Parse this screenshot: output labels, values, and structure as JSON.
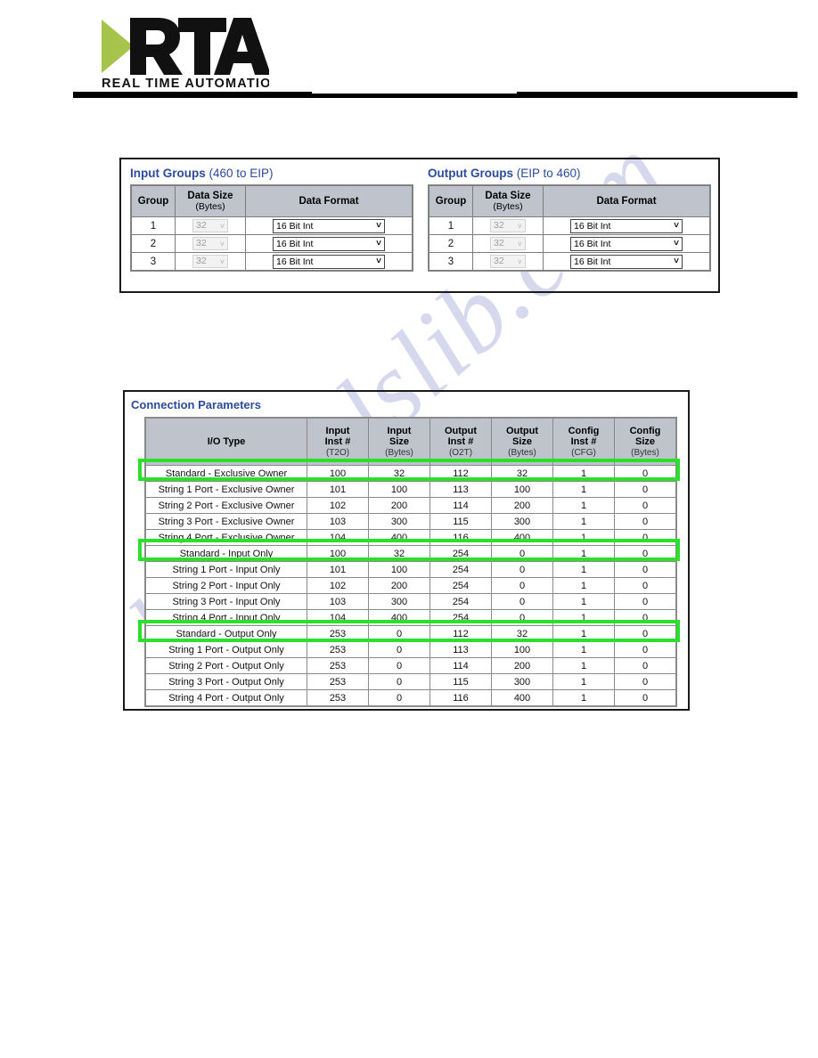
{
  "header": {
    "logo_main": "RTA",
    "logo_tagline": "REAL TIME AUTOMATION"
  },
  "watermark": {
    "text": "manualslib.com"
  },
  "groups_panel": {
    "input": {
      "title_bold": "Input Groups",
      "title_paren": " (460 to EIP)",
      "columns": [
        "Group",
        "Data Size",
        "(Bytes)",
        "Data Format"
      ],
      "col_group": "Group",
      "col_size": "Data Size",
      "col_size_sub": "(Bytes)",
      "col_format": "Data Format",
      "rows": [
        {
          "group": "1",
          "size": "32",
          "format": "16 Bit Int"
        },
        {
          "group": "2",
          "size": "32",
          "format": "16 Bit Int"
        },
        {
          "group": "3",
          "size": "32",
          "format": "16 Bit Int"
        }
      ]
    },
    "output": {
      "title_bold": "Output Groups",
      "title_paren": " (EIP to 460)",
      "col_group": "Group",
      "col_size": "Data Size",
      "col_size_sub": "(Bytes)",
      "col_format": "Data Format",
      "rows": [
        {
          "group": "1",
          "size": "32",
          "format": "16 Bit Int"
        },
        {
          "group": "2",
          "size": "32",
          "format": "16 Bit Int"
        },
        {
          "group": "3",
          "size": "32",
          "format": "16 Bit Int"
        }
      ]
    },
    "caret": "˅"
  },
  "connection_parameters": {
    "title": "Connection Parameters",
    "headers": [
      {
        "main": "I/O Type",
        "sub": ""
      },
      {
        "main": "Input",
        "main2": "Inst #",
        "sub": "(T2O)"
      },
      {
        "main": "Input",
        "main2": "Size",
        "sub": "(Bytes)"
      },
      {
        "main": "Output",
        "main2": "Inst #",
        "sub": "(O2T)"
      },
      {
        "main": "Output",
        "main2": "Size",
        "sub": "(Bytes)"
      },
      {
        "main": "Config",
        "main2": "Inst #",
        "sub": "(CFG)"
      },
      {
        "main": "Config",
        "main2": "Size",
        "sub": "(Bytes)"
      }
    ],
    "rows": [
      {
        "type": "Standard - Exclusive Owner",
        "input_inst": "100",
        "input_size": "32",
        "output_inst": "112",
        "output_size": "32",
        "config_inst": "1",
        "config_size": "0",
        "highlighted": true
      },
      {
        "type": "String 1 Port - Exclusive Owner",
        "input_inst": "101",
        "input_size": "100",
        "output_inst": "113",
        "output_size": "100",
        "config_inst": "1",
        "config_size": "0",
        "highlighted": false
      },
      {
        "type": "String 2 Port - Exclusive Owner",
        "input_inst": "102",
        "input_size": "200",
        "output_inst": "114",
        "output_size": "200",
        "config_inst": "1",
        "config_size": "0",
        "highlighted": false
      },
      {
        "type": "String 3 Port - Exclusive Owner",
        "input_inst": "103",
        "input_size": "300",
        "output_inst": "115",
        "output_size": "300",
        "config_inst": "1",
        "config_size": "0",
        "highlighted": false
      },
      {
        "type": "String 4 Port - Exclusive Owner",
        "input_inst": "104",
        "input_size": "400",
        "output_inst": "116",
        "output_size": "400",
        "config_inst": "1",
        "config_size": "0",
        "highlighted": false
      },
      {
        "type": "Standard - Input Only",
        "input_inst": "100",
        "input_size": "32",
        "output_inst": "254",
        "output_size": "0",
        "config_inst": "1",
        "config_size": "0",
        "highlighted": true
      },
      {
        "type": "String 1 Port - Input Only",
        "input_inst": "101",
        "input_size": "100",
        "output_inst": "254",
        "output_size": "0",
        "config_inst": "1",
        "config_size": "0",
        "highlighted": false
      },
      {
        "type": "String 2 Port - Input Only",
        "input_inst": "102",
        "input_size": "200",
        "output_inst": "254",
        "output_size": "0",
        "config_inst": "1",
        "config_size": "0",
        "highlighted": false
      },
      {
        "type": "String 3 Port - Input Only",
        "input_inst": "103",
        "input_size": "300",
        "output_inst": "254",
        "output_size": "0",
        "config_inst": "1",
        "config_size": "0",
        "highlighted": false
      },
      {
        "type": "String 4 Port - Input Only",
        "input_inst": "104",
        "input_size": "400",
        "output_inst": "254",
        "output_size": "0",
        "config_inst": "1",
        "config_size": "0",
        "highlighted": false
      },
      {
        "type": "Standard - Output Only",
        "input_inst": "253",
        "input_size": "0",
        "output_inst": "112",
        "output_size": "32",
        "config_inst": "1",
        "config_size": "0",
        "highlighted": true
      },
      {
        "type": "String 1 Port - Output Only",
        "input_inst": "253",
        "input_size": "0",
        "output_inst": "113",
        "output_size": "100",
        "config_inst": "1",
        "config_size": "0",
        "highlighted": false
      },
      {
        "type": "String 2 Port - Output Only",
        "input_inst": "253",
        "input_size": "0",
        "output_inst": "114",
        "output_size": "200",
        "config_inst": "1",
        "config_size": "0",
        "highlighted": false
      },
      {
        "type": "String 3 Port - Output Only",
        "input_inst": "253",
        "input_size": "0",
        "output_inst": "115",
        "output_size": "300",
        "config_inst": "1",
        "config_size": "0",
        "highlighted": false
      },
      {
        "type": "String 4 Port - Output Only",
        "input_inst": "253",
        "input_size": "0",
        "output_inst": "116",
        "output_size": "400",
        "config_inst": "1",
        "config_size": "0",
        "highlighted": false
      }
    ]
  },
  "colors": {
    "heading_blue": "#2b4b9b",
    "table_header_gray": "#bfc3cc",
    "highlight_green": "#2ae02a",
    "logo_green": "#a6c34c",
    "watermark_lilac": "#c9cbe8"
  }
}
